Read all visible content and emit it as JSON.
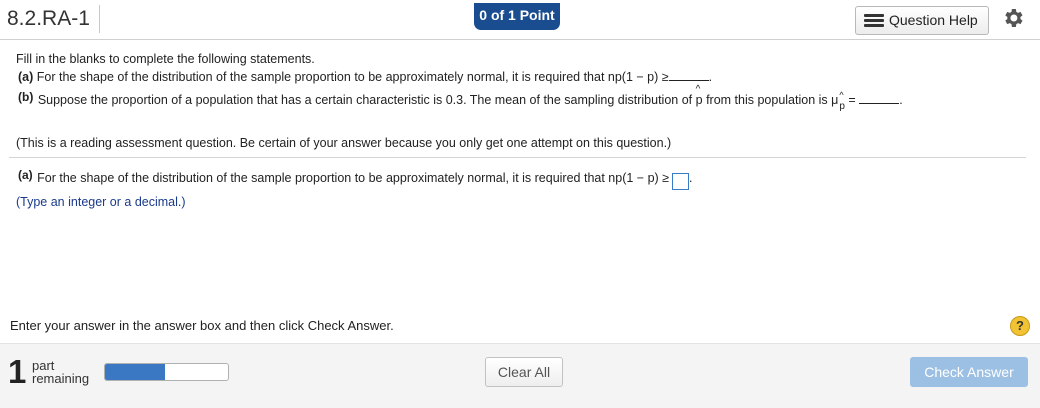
{
  "header": {
    "question_id": "8.2.RA-1",
    "points_badge": "0 of 1 Point",
    "help_button": "Question Help"
  },
  "question": {
    "intro": "Fill in the blanks to complete the following statements.",
    "part_a": {
      "label": "(a)",
      "text": "For the shape of the distribution of the sample proportion to be approximately normal, it is required that np(1 − p) ≥",
      "blank_suffix": "."
    },
    "part_b": {
      "label": "(b)",
      "text_before": "Suppose the proportion of a population that has a certain characteristic is 0.3. The mean of the sampling distribution of",
      "p_symbol": "p",
      "text_after": "from this population is",
      "mu_symbol": "μ",
      "mu_sub": "p",
      "equals": "=",
      "blank_suffix": "."
    },
    "note": "(This is a reading assessment question.  Be certain of your answer because you only get one attempt on this question.)"
  },
  "answer_section": {
    "label": "(a)",
    "text": "For the shape of the distribution of the sample proportion to be approximately normal, it is required that np(1 − p) ≥",
    "input_value": "",
    "suffix": ".",
    "hint": "(Type an integer or a decimal.)"
  },
  "footer": {
    "instruction": "Enter your answer in the answer box and then click Check Answer.",
    "help_symbol": "?",
    "parts_count": "1",
    "parts_label_line1": "part",
    "parts_label_line2": "remaining",
    "progress_fraction": 0.49,
    "clear_button": "Clear All",
    "check_button": "Check Answer"
  },
  "colors": {
    "badge": "#1a4d8f",
    "hint_text": "#1a3a8a",
    "progress_fill": "#3a78c4",
    "check_button": "#9cc0e4",
    "help_circle": "#f1c232"
  },
  "icons": {
    "help_button_icon": "list-icon",
    "settings": "gear-icon",
    "help": "question-mark-icon"
  }
}
